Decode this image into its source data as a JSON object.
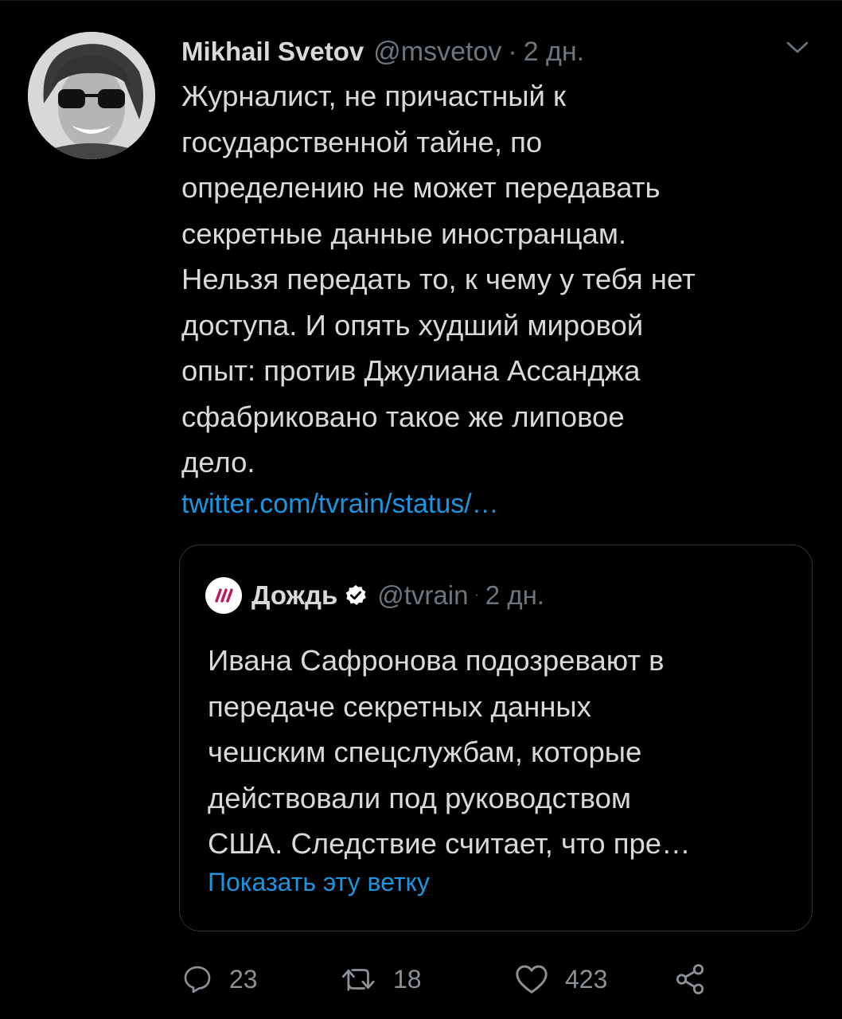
{
  "tweet": {
    "author_name": "Mikhail Svetov",
    "handle": "@msvetov",
    "separator": "·",
    "time": "2 дн.",
    "text": "Журналист, не причастный к\nгосударственной тайне, по\nопределению не может передавать\nсекретные данные иностранцам.\nНельзя передать то, к чему у тебя нет\nдоступа. И опять худший мировой\nопыт: против Джулиана Ассанджа\nсфабриковано такое же липовое\nдело.",
    "link": "twitter.com/tvrain/status/…"
  },
  "quote": {
    "author_name": "Дождь",
    "handle": "@tvrain",
    "separator": "·",
    "time": "2 дн.",
    "text": "Ивана Сафронова подозревают в\nпередаче секретных данных\nчешским спецслужбам, которые\nдействовали под руководством\nСША. Следствие считает, что пре…",
    "show_thread": "Показать эту ветку",
    "verified": true
  },
  "actions": {
    "replies": "23",
    "retweets": "18",
    "likes": "423"
  },
  "icons": {
    "reply": "reply-icon",
    "retweet": "retweet-icon",
    "like": "heart-icon",
    "share": "share-icon",
    "menu": "chevron-down-icon",
    "verified": "verified-badge-icon"
  },
  "colors": {
    "background": "#000000",
    "text": "#d9d9d9",
    "secondary": "#6e767d",
    "link": "#1b95e0",
    "border": "#2f3336",
    "rain_logo": "#c2185b"
  }
}
